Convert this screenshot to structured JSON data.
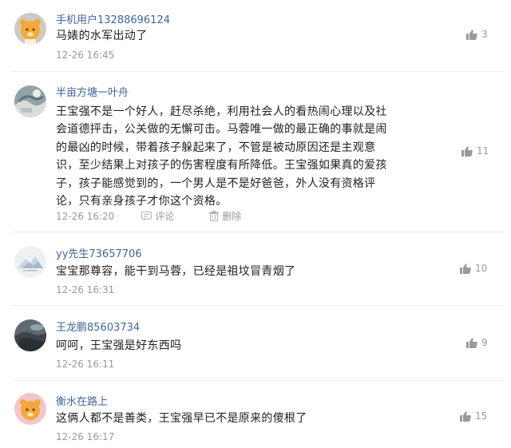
{
  "comments": [
    {
      "username": "手机用户13288696124",
      "avatar": "orange-bear-cartoon",
      "lines": [
        "马婊的水军出动了"
      ],
      "time": "12-26 16:45",
      "likes": "3"
    },
    {
      "username": "半亩方塘一叶舟",
      "avatar": "grey-landscape-photo",
      "lines": [
        "王宝强不是一个好人，赶尽杀绝，利用社会人的看热闹心理以及社",
        "会道德抨击，公关做的无懈可击。马蓉唯一做的最正确的事就是闹",
        "的最凶的时候，带着孩子躲起来了，不管是被动原因还是主观意",
        "识，至少结果上对孩子的伤害程度有所降低。王宝强如果真的爱孩",
        "子，孩子能感觉到的，一个男人是不是好爸爸，外人没有资格评",
        "论，只有亲身孩子才你这个资格。"
      ],
      "time": "12-26 16:20",
      "reply_label": "评论",
      "delete_label": "删除",
      "likes": "11"
    },
    {
      "username": "yy先生73657706",
      "avatar": "pale-mountain-logo",
      "lines": [
        "宝宝那尊容，能干到马蓉，已经是祖坟冒青烟了"
      ],
      "time": "12-26 16:31",
      "likes": "10"
    },
    {
      "username": "王龙鹏85603734",
      "avatar": "dark-rock-photo",
      "lines": [
        "呵呵，王宝强是好东西吗"
      ],
      "time": "12-26 16:11",
      "likes": "9"
    },
    {
      "username": "衡水在路上",
      "avatar": "pink-bear-cartoon",
      "lines": [
        "这俩人都不是善类，王宝强早已不是原来的傻根了"
      ],
      "time": "12-26 16:17",
      "likes": "15"
    }
  ],
  "colors": {
    "username": "#406599",
    "text": "#222222",
    "meta": "#999999",
    "divider": "#ececec"
  },
  "icons": {
    "like": "thumbs-up-icon",
    "reply": "comment-icon",
    "delete": "trash-icon"
  }
}
